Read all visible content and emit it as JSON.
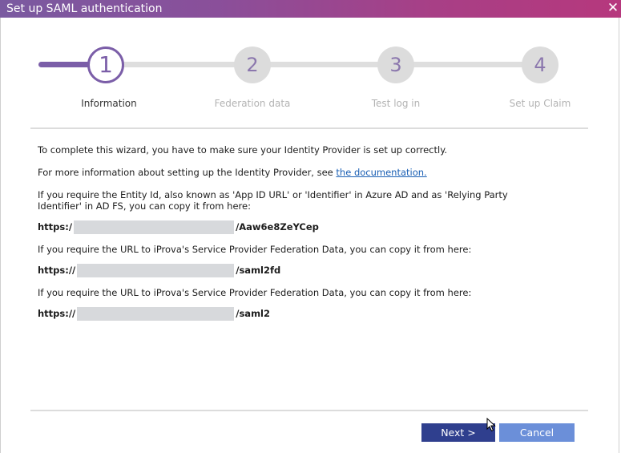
{
  "dialog": {
    "title": "Set up SAML authentication",
    "close_glyph": "✕"
  },
  "steps": [
    {
      "number": "1",
      "label": "Information",
      "state": "active"
    },
    {
      "number": "2",
      "label": "Federation data",
      "state": "inactive"
    },
    {
      "number": "3",
      "label": "Test log in",
      "state": "inactive"
    },
    {
      "number": "4",
      "label": "Set up Claim",
      "state": "inactive"
    }
  ],
  "body": {
    "intro": "To complete this wizard, you have to make sure your Identity Provider is set up correctly.",
    "more_info_prefix": "For more information about setting up the Identity Provider, see ",
    "more_info_link": "the documentation.",
    "entity_id_text": "If you require the Entity Id, also known as 'App ID URL' or 'Identifier' in Azure AD and as 'Relying Party Identifier' in AD FS, you can copy it from here:",
    "entity_id_url_prefix": "https:/",
    "entity_id_url_suffix": "/Aaw6e8ZeYCep",
    "federation_text_1": "If you require the URL to iProva's Service Provider Federation Data, you can copy it from here:",
    "federation_url_1_prefix": "https://",
    "federation_url_1_suffix": "/saml2fd",
    "federation_text_2": "If you require the URL to iProva's Service Provider Federation Data, you can copy it from here:",
    "federation_url_2_prefix": "https://",
    "federation_url_2_suffix": "/saml2"
  },
  "buttons": {
    "next": "Next >",
    "cancel": "Cancel"
  },
  "colors": {
    "accent": "#7b5ea8",
    "next_button": "#2f3f8e",
    "cancel_button": "#6b8fd9",
    "link": "#1a5fb4",
    "inactive_step": "#dcdcdc"
  }
}
